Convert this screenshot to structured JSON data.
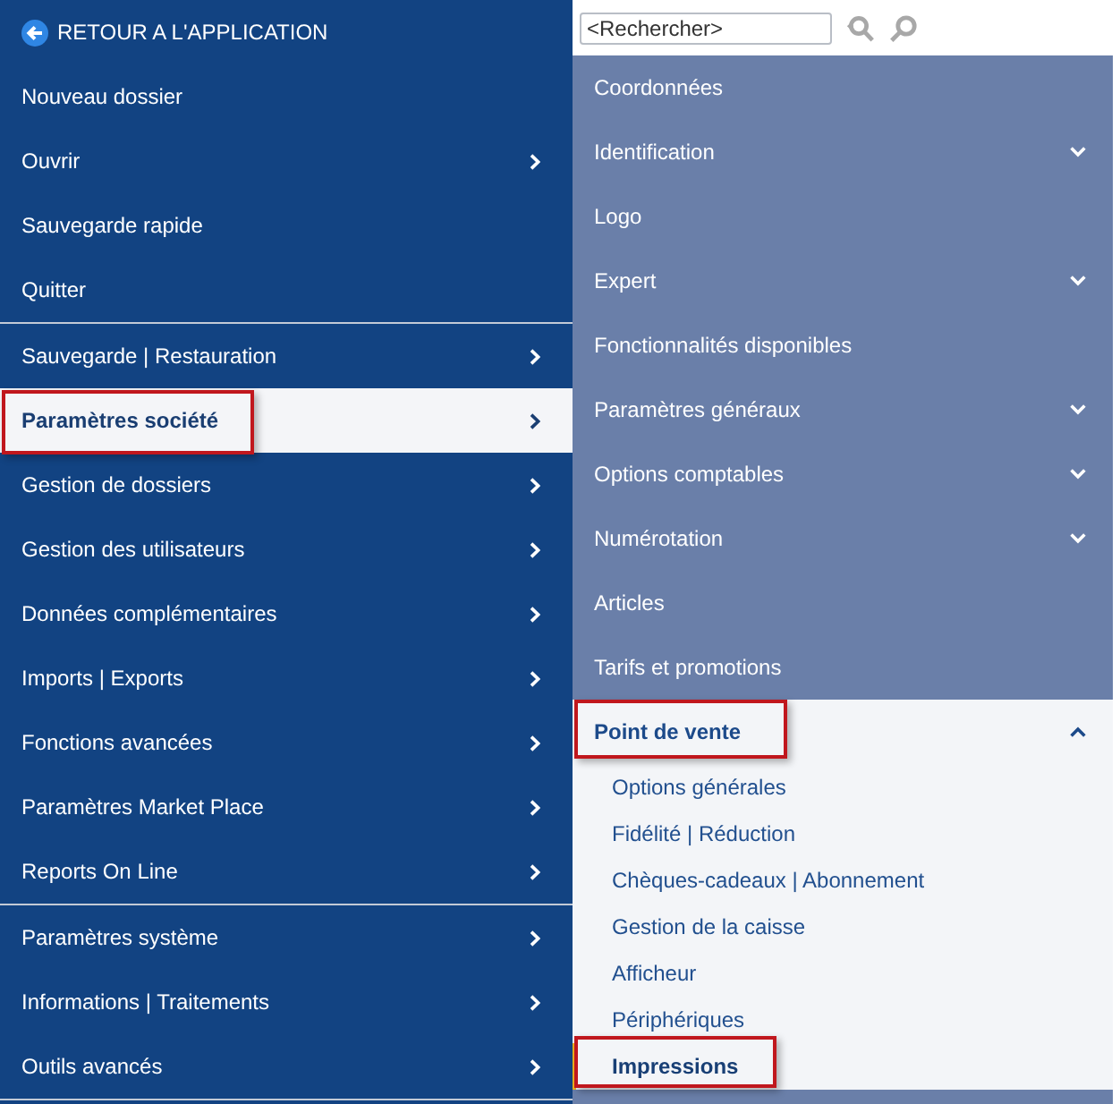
{
  "back_link": {
    "label": "RETOUR A L'APPLICATION"
  },
  "main_menu": {
    "groups": [
      {
        "items": [
          {
            "label": "Nouveau dossier",
            "has_submenu": false,
            "selected": false,
            "highlighted": false
          },
          {
            "label": "Ouvrir",
            "has_submenu": true,
            "selected": false,
            "highlighted": false
          },
          {
            "label": "Sauvegarde rapide",
            "has_submenu": false,
            "selected": false,
            "highlighted": false
          },
          {
            "label": "Quitter",
            "has_submenu": false,
            "selected": false,
            "highlighted": false
          }
        ]
      },
      {
        "items": [
          {
            "label": "Sauvegarde | Restauration",
            "has_submenu": true,
            "selected": false,
            "highlighted": false
          },
          {
            "label": "Paramètres société",
            "has_submenu": true,
            "selected": true,
            "highlighted": true
          },
          {
            "label": "Gestion de dossiers",
            "has_submenu": true,
            "selected": false,
            "highlighted": false
          },
          {
            "label": "Gestion des utilisateurs",
            "has_submenu": true,
            "selected": false,
            "highlighted": false
          },
          {
            "label": "Données complémentaires",
            "has_submenu": true,
            "selected": false,
            "highlighted": false
          },
          {
            "label": "Imports | Exports",
            "has_submenu": true,
            "selected": false,
            "highlighted": false
          },
          {
            "label": "Fonctions avancées",
            "has_submenu": true,
            "selected": false,
            "highlighted": false
          },
          {
            "label": "Paramètres Market Place",
            "has_submenu": true,
            "selected": false,
            "highlighted": false
          },
          {
            "label": "Reports On Line",
            "has_submenu": true,
            "selected": false,
            "highlighted": false
          }
        ]
      },
      {
        "items": [
          {
            "label": "Paramètres système",
            "has_submenu": true,
            "selected": false,
            "highlighted": false
          },
          {
            "label": "Informations | Traitements",
            "has_submenu": true,
            "selected": false,
            "highlighted": false
          },
          {
            "label": "Outils avancés",
            "has_submenu": true,
            "selected": false,
            "highlighted": false
          }
        ]
      }
    ]
  },
  "search": {
    "placeholder": "<Rechercher>"
  },
  "settings_menu": {
    "items": [
      {
        "kind": "link",
        "label": "Coordonnées",
        "highlighted": false
      },
      {
        "kind": "group",
        "label": "Identification",
        "expanded": false,
        "highlighted": false
      },
      {
        "kind": "link",
        "label": "Logo",
        "highlighted": false
      },
      {
        "kind": "group",
        "label": "Expert",
        "expanded": false,
        "highlighted": false
      },
      {
        "kind": "link",
        "label": "Fonctionnalités disponibles",
        "highlighted": false
      },
      {
        "kind": "group",
        "label": "Paramètres généraux",
        "expanded": false,
        "highlighted": false
      },
      {
        "kind": "group",
        "label": "Options comptables",
        "expanded": false,
        "highlighted": false
      },
      {
        "kind": "group",
        "label": "Numérotation",
        "expanded": false,
        "highlighted": false
      },
      {
        "kind": "link",
        "label": "Articles",
        "highlighted": false
      },
      {
        "kind": "link",
        "label": "Tarifs et promotions",
        "highlighted": false
      },
      {
        "kind": "group",
        "label": "Point de vente",
        "expanded": true,
        "highlighted": true,
        "children": [
          {
            "label": "Options générales",
            "selected": false,
            "highlighted": false
          },
          {
            "label": "Fidélité | Réduction",
            "selected": false,
            "highlighted": false
          },
          {
            "label": "Chèques-cadeaux | Abonnement",
            "selected": false,
            "highlighted": false
          },
          {
            "label": "Gestion de la caisse",
            "selected": false,
            "highlighted": false
          },
          {
            "label": "Afficheur",
            "selected": false,
            "highlighted": false
          },
          {
            "label": "Périphériques",
            "selected": false,
            "highlighted": false
          },
          {
            "label": "Impressions",
            "selected": true,
            "highlighted": true
          }
        ]
      }
    ]
  }
}
